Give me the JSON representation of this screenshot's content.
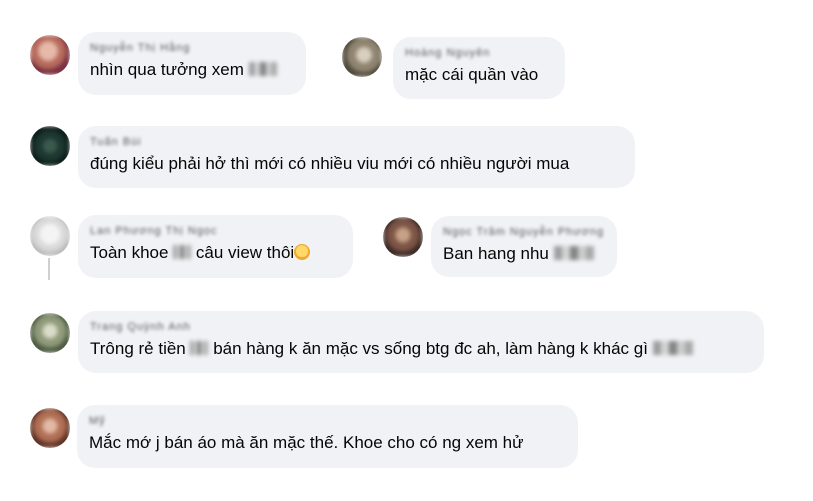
{
  "comments": [
    {
      "id": "c1",
      "author": "Nguyễn Thị Hằng",
      "text": "nhìn qua tưởng xem",
      "has_redacted_suffix": true
    },
    {
      "id": "c2",
      "author": "Hoàng Nguyên",
      "text": "mặc cái quần vào",
      "has_redacted_suffix": false
    },
    {
      "id": "c3",
      "author": "Tuấn Bùi",
      "text": "đúng kiểu phải hở thì mới có nhiều viu mới có nhiều người mua",
      "has_redacted_suffix": false
    },
    {
      "id": "c4",
      "author": "Lan Phương Thị Ngọc",
      "text_before": "Toàn khoe",
      "text_after": "câu view thôi",
      "has_emoji": true
    },
    {
      "id": "c5",
      "author": "Ngọc Trâm Nguyễn Phương",
      "text": "Ban hang nhu",
      "has_redacted_suffix": true
    },
    {
      "id": "c6",
      "author": "Trang Quỳnh Anh",
      "text_before": "Trông rẻ tiền",
      "text_after": "bán hàng k ăn mặc vs sống btg đc ah, làm hàng k khác gì",
      "has_redacted_suffix": true
    },
    {
      "id": "c7",
      "author": "Mỹ",
      "text": "Mắc mớ j bán áo mà ăn mặc thế. Khoe cho có ng xem hử",
      "has_redacted_suffix": false
    }
  ],
  "colors": {
    "bubble": "#f0f2f5",
    "text": "#050505",
    "line": "#ced0d4"
  }
}
